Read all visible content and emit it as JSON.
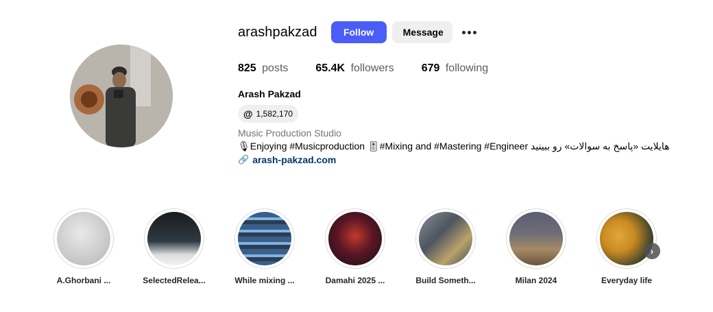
{
  "profile": {
    "username": "arashpakzad",
    "follow_label": "Follow",
    "message_label": "Message",
    "stats": {
      "posts_count": "825",
      "posts_label": "posts",
      "followers_count": "65.4K",
      "followers_label": "followers",
      "following_count": "679",
      "following_label": "following"
    },
    "full_name": "Arash Pakzad",
    "threads_icon": "@",
    "threads_count": "1,582,170",
    "category": "Music Production Studio",
    "bio": "🎙Enjoying #Musicproduction 🎚#Mixing and #Mastering #Engineer هایلایت «پاسخ به سوالات» رو ببینید",
    "link": "arash-pakzad.com"
  },
  "highlights": [
    {
      "label": "A.Ghorbani ..."
    },
    {
      "label": "SelectedRelea..."
    },
    {
      "label": "While mixing ..."
    },
    {
      "label": "Damahi 2025 ..."
    },
    {
      "label": "Build Someth..."
    },
    {
      "label": "Milan 2024"
    },
    {
      "label": "Everyday life"
    }
  ],
  "next_arrow": "›"
}
